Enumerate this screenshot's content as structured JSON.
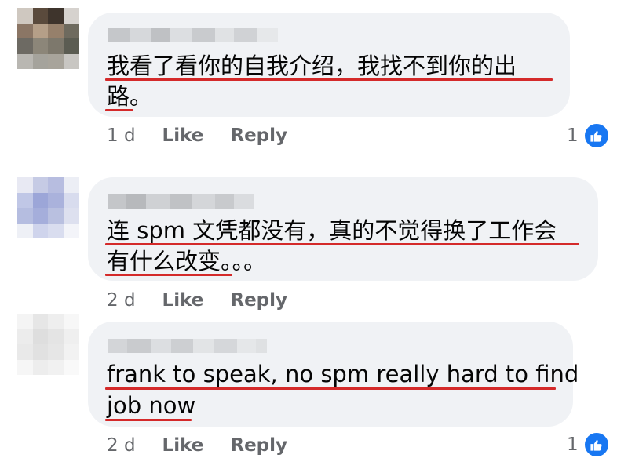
{
  "comments": [
    {
      "lines": [
        "我看了看你的自我介绍，我找不到你的出",
        "路。"
      ],
      "time": "1 d",
      "like_label": "Like",
      "reply_label": "Reply",
      "reaction_count": "1",
      "reaction_icon": "thumbs-up-icon"
    },
    {
      "lines": [
        "连 spm 文凭都没有，真的不觉得换了工作会",
        "有什么改变。。。"
      ],
      "time": "2 d",
      "like_label": "Like",
      "reply_label": "Reply"
    },
    {
      "lines": [
        "frank to speak, no spm really hard to find",
        "job now"
      ],
      "time": "2 d",
      "like_label": "Like",
      "reply_label": "Reply",
      "reaction_count": "1",
      "reaction_icon": "thumbs-up-icon"
    }
  ],
  "colors": {
    "bubble": "#f0f2f5",
    "underline": "#d42a2a",
    "reaction": "#1877f2",
    "meta_text": "#65676b"
  }
}
